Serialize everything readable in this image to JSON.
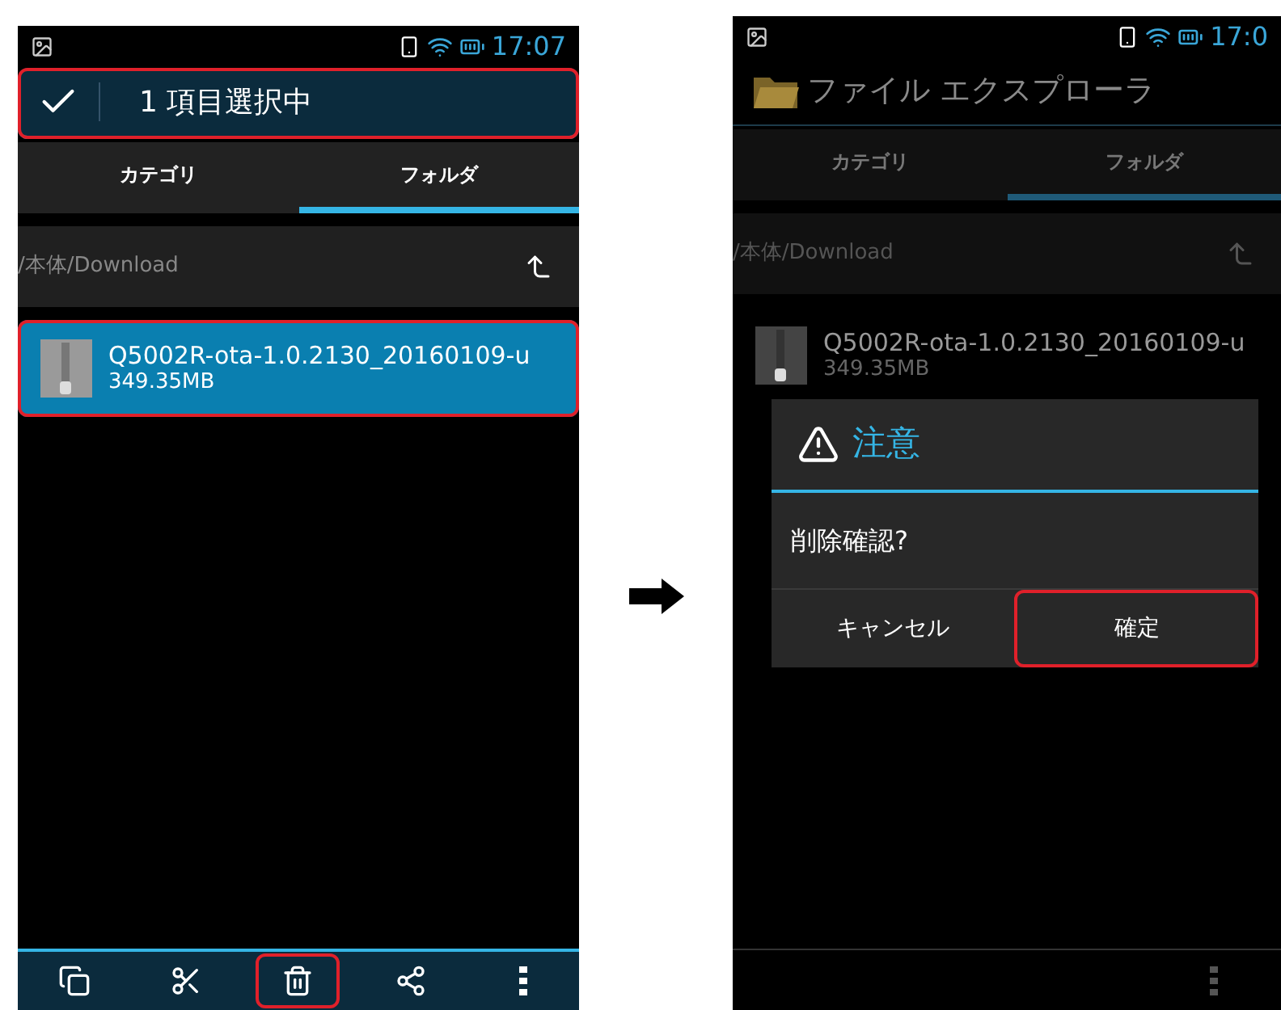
{
  "screens": [
    {
      "status_bar": {
        "time": "17:07"
      },
      "header": {
        "kind": "selection",
        "title": "1 項目選択中",
        "highlighted": true
      },
      "tabs": [
        {
          "label": "カテゴリ",
          "selected": false
        },
        {
          "label": "フォルダ",
          "selected": true
        }
      ],
      "path": "/本体/Download",
      "files": [
        {
          "name": "Q5002R-ota-1.0.2130_20160109-u",
          "size": "349.35MB",
          "selected": true,
          "highlighted": true
        }
      ],
      "bottom_actions": [
        {
          "kind": "copy",
          "highlighted": false
        },
        {
          "kind": "cut",
          "highlighted": false
        },
        {
          "kind": "delete",
          "highlighted": true
        },
        {
          "kind": "share",
          "highlighted": false
        },
        {
          "kind": "more",
          "highlighted": false
        }
      ]
    },
    {
      "status_bar": {
        "time": "17:0"
      },
      "header": {
        "kind": "title",
        "title": "ファイル エクスプローラ",
        "highlighted": false
      },
      "tabs": [
        {
          "label": "カテゴリ",
          "selected": false
        },
        {
          "label": "フォルダ",
          "selected": true
        }
      ],
      "path": "/本体/Download",
      "files": [
        {
          "name": "Q5002R-ota-1.0.2130_20160109-u",
          "size": "349.35MB",
          "selected": false,
          "highlighted": false
        }
      ],
      "dialog": {
        "title": "注意",
        "message": "削除確認?",
        "buttons": [
          {
            "label": "キャンセル",
            "highlighted": false
          },
          {
            "label": "確定",
            "highlighted": true
          }
        ]
      },
      "bottom_actions": [
        {
          "kind": "more",
          "highlighted": false
        }
      ]
    }
  ]
}
